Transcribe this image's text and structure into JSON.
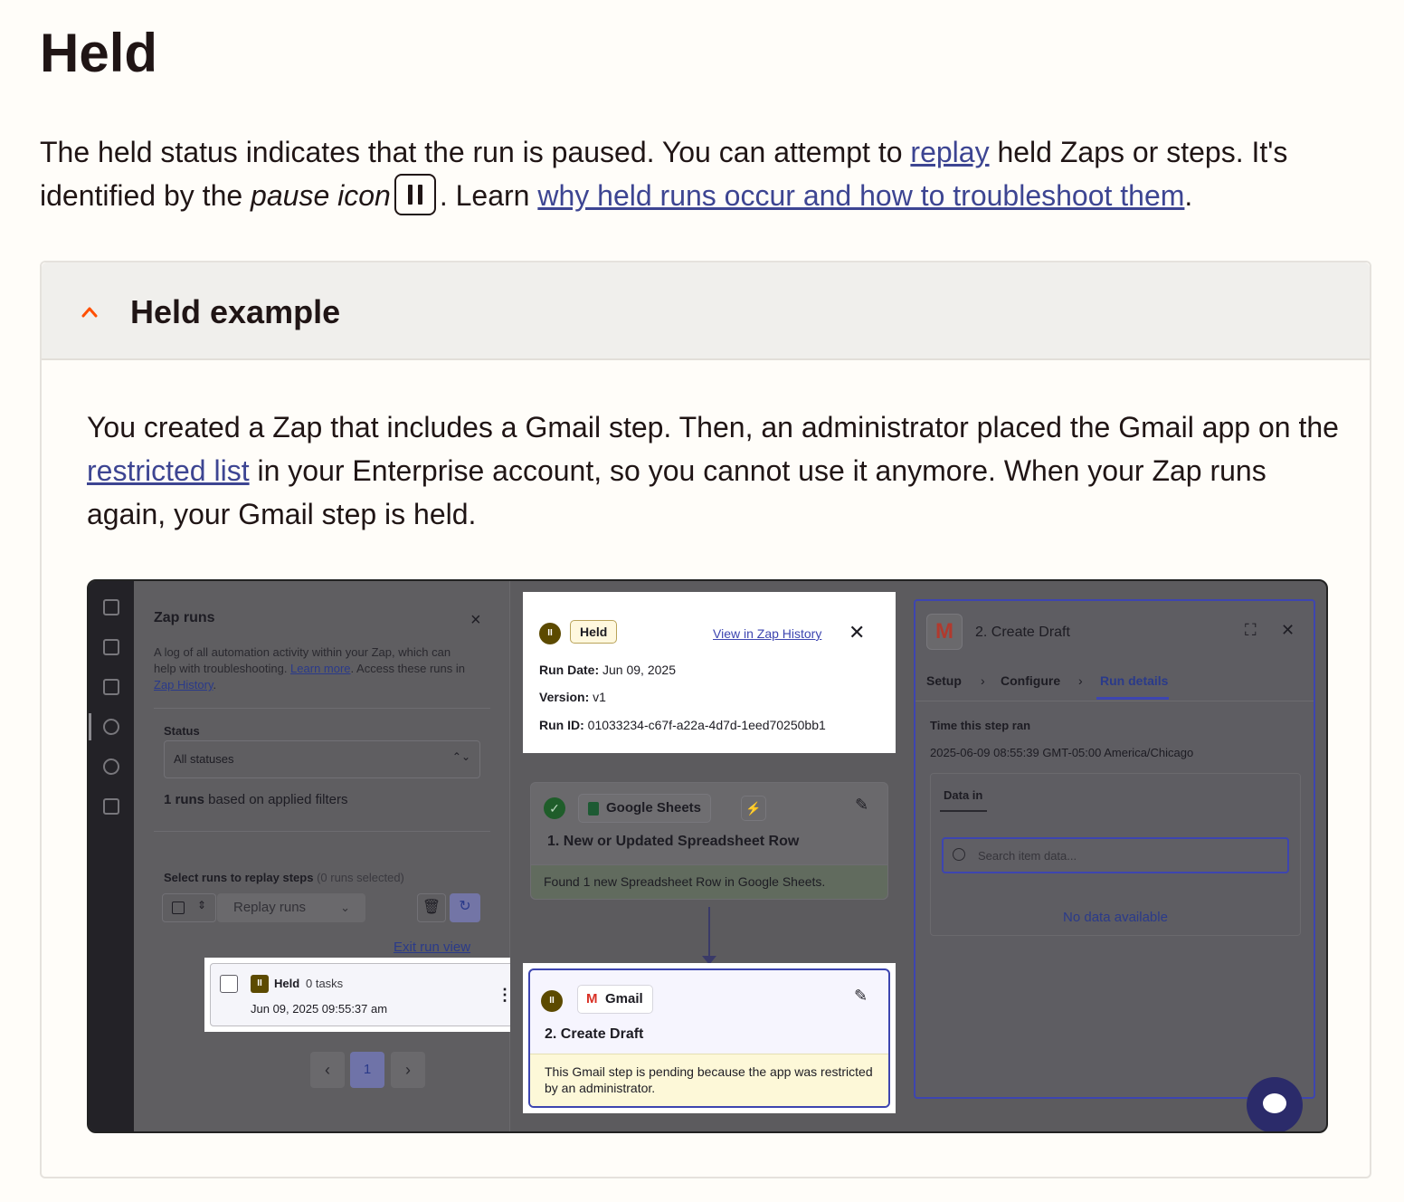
{
  "title": "Held",
  "intro": {
    "part1": "The held status indicates that the run is paused. You can attempt to ",
    "link_replay": "replay",
    "part2": " held Zaps or steps. It's identified by the ",
    "pause_icon_text": "pause icon",
    "part3": ". Learn ",
    "link_why": "why held runs occur and how to troubleshoot them",
    "part4": "."
  },
  "accordion": {
    "title": "Held example",
    "body_part1": "You created a Zap that includes a Gmail step. Then, an administrator placed the Gmail app on the ",
    "link_restricted": "restricted list",
    "body_part2": " in your Enterprise account, so you cannot use it anymore. When your Zap runs again, your Gmail step is held."
  },
  "screenshot": {
    "left_panel": {
      "title": "Zap runs",
      "close": "×",
      "description_part1": "A log of all automation activity within your Zap, which can help with troubleshooting. ",
      "learn_more": "Learn more",
      "description_part2": ". Access these runs in ",
      "zap_history_link": "Zap History",
      "description_part3": ".",
      "status_label": "Status",
      "status_value": "All statuses",
      "runs_count_bold": "1 runs",
      "runs_count_rest": " based on applied filters",
      "select_label_bold": "Select runs to replay steps",
      "select_label_muted": " (0 runs selected)",
      "replay_button": "Replay runs",
      "exit_run_view": "Exit run view",
      "run": {
        "status": "Held",
        "tasks": "0 tasks",
        "date": "Jun 09, 2025 09:55:37 am"
      },
      "pagination": {
        "current": "1"
      }
    },
    "run_info": {
      "status": "Held",
      "view_link": "View in Zap History",
      "run_date_label": "Run Date:",
      "run_date": "Jun 09, 2025",
      "version_label": "Version:",
      "version": "v1",
      "run_id_label": "Run ID:",
      "run_id": "01033234-c67f-a22a-4d7d-1eed70250bb1"
    },
    "step1": {
      "app": "Google Sheets",
      "title": "1. New or Updated Spreadsheet Row",
      "result": "Found 1 new Spreadsheet Row in Google Sheets."
    },
    "step2": {
      "app": "Gmail",
      "title": "2. Create Draft",
      "note": "This Gmail step is pending because the app was restricted by an administrator."
    },
    "right_panel": {
      "title": "2. Create Draft",
      "tabs": [
        "Setup",
        "Configure",
        "Run details"
      ],
      "time_label": "Time this step ran",
      "time_value": "2025-06-09 08:55:39 GMT-05:00 America/Chicago",
      "data_in": "Data in",
      "search_placeholder": "Search item data...",
      "no_data": "No data available"
    }
  },
  "colors": {
    "link": "#3d45b0",
    "accent_chevron": "#ff4f00",
    "held_brown": "#5c4a00",
    "pending_yellow": "#fdf8d8"
  }
}
